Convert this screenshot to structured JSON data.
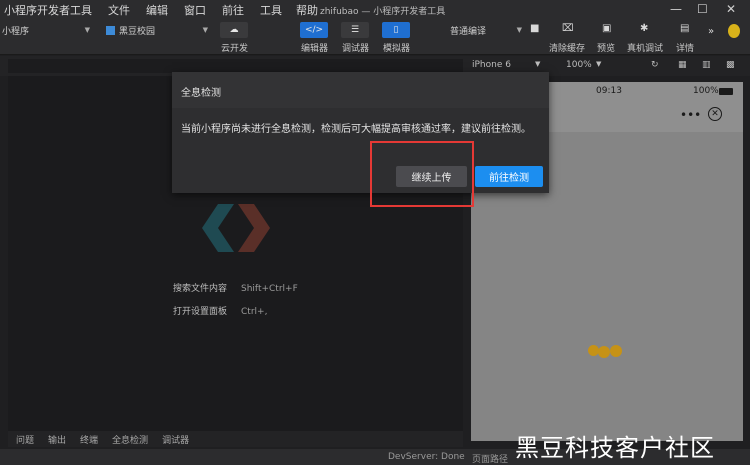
{
  "menu": {
    "items": [
      "小程序开发者工具",
      "文件",
      "编辑",
      "窗口",
      "前往",
      "工具",
      "帮助"
    ],
    "window_title": "zhifubao — 小程序开发者工具"
  },
  "toolbar": {
    "mode_select": "小程序",
    "project_select": "黑豆校园",
    "cloud_label": "云开发",
    "editor_label": "编辑器",
    "debugger_label": "调试器",
    "simulator_label": "模拟器",
    "compile_select": "普通编译",
    "clear_cache_label": "清除缓存",
    "preview_label": "预览",
    "device_debug_label": "真机调试",
    "details_label": "详情",
    "more_label": "»"
  },
  "sim_toolbar": {
    "device": "iPhone 6",
    "zoom": "100%"
  },
  "simulator": {
    "time": "09:13",
    "battery": "100%"
  },
  "editor": {
    "search_files": "搜索文件内容",
    "search_key": "Shift+Ctrl+F",
    "open_settings": "打开设置面板",
    "settings_key": "Ctrl+,"
  },
  "bottom_tabs": [
    "问题",
    "输出",
    "终端",
    "全息检测",
    "调试器"
  ],
  "status": {
    "devserver": "DevServer: Done",
    "page_path_label": "页面路径"
  },
  "modal": {
    "title": "全息检测",
    "message": "当前小程序尚未进行全息检测，检测后可大幅提高审核通过率，建议前往检测。",
    "continue_button": "继续上传",
    "go_button": "前往检测"
  },
  "watermark": "黑豆科技客户社区",
  "colors": {
    "accent_blue": "#1c8ef0",
    "highlight_red": "#e53935",
    "loading_dot": "#c69216"
  }
}
